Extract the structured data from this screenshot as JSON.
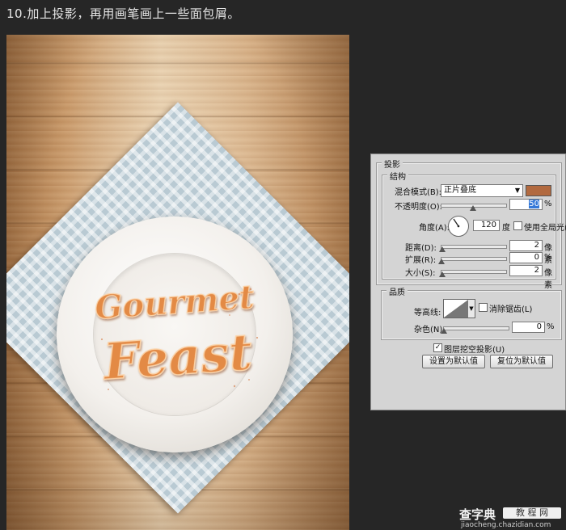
{
  "step_title": "10.加上投影，再用画笔画上一些面包屑。",
  "artwork": {
    "line1": "Gourmet",
    "line2": "Feast",
    "text_color": "#e38a45",
    "napkin_color": "#b9cad3"
  },
  "panel": {
    "title": "投影",
    "structure": {
      "title": "结构",
      "blend_mode_label": "混合模式(B):",
      "blend_mode_value": "正片叠底",
      "color": "#b26a40",
      "opacity_label": "不透明度(O):",
      "opacity_value": "50",
      "opacity_unit": "%",
      "angle_label": "角度(A):",
      "angle_value": "120",
      "angle_unit": "度",
      "global_light_label": "使用全局光(G)",
      "distance_label": "距离(D):",
      "distance_value": "2",
      "distance_unit": "像素",
      "spread_label": "扩展(R):",
      "spread_value": "0",
      "spread_unit": "%",
      "size_label": "大小(S):",
      "size_value": "2",
      "size_unit": "像素"
    },
    "quality": {
      "title": "品质",
      "contour_label": "等高线:",
      "antialias_label": "消除锯齿(L)",
      "noise_label": "杂色(N):",
      "noise_value": "0",
      "noise_unit": "%"
    },
    "knockout_label": "图层挖空投影(U)",
    "knockout_check": "✓",
    "default_set_button": "设置为默认值",
    "default_reset_button": "复位为默认值"
  },
  "watermark": {
    "brand": "查字典",
    "badge": "教 程 网",
    "url": "jiaocheng.chazidian.com"
  }
}
